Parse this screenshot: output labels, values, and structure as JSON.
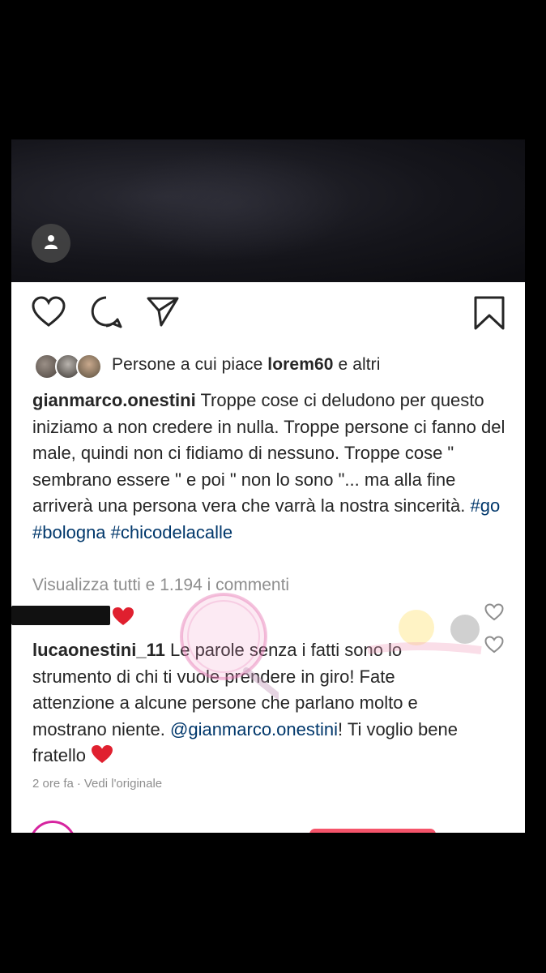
{
  "post": {
    "likes": {
      "prefix": "Persone a cui piace",
      "user": "lorem60",
      "suffix": "e altri"
    },
    "caption": {
      "username": "gianmarco.onestini",
      "text": "Troppe cose ci deludono per questo iniziamo a non credere in nulla. Troppe persone ci fanno del male, quindi non ci fidiamo di nessuno. Troppe cose \" sembrano essere \" e poi \" non lo sono \"... ma alla fine arriverà una persona vera che varrà la nostra sincerità.",
      "hashtags": [
        "#go",
        "#bologna",
        "#chicodelacalle"
      ]
    },
    "view_all_comments": "Visualizza tutti e 1.194 i commenti",
    "comment": {
      "username": "lucaonestini_11",
      "text_before_mention": "Le parole senza i fatti sono lo strumento di chi ti vuole prendere in giro! Fate attenzione a alcune persone che parlano molto e mostrano niente.",
      "mention": "@gianmarco.onestini",
      "text_after_mention": "! Ti voglio bene fratello",
      "time": "2 ore fa",
      "see_original": "Vedi l'originale"
    }
  },
  "icons": {
    "profile": "person-icon",
    "like": "heart-outline-icon",
    "comment": "comment-icon",
    "share": "send-icon",
    "save": "bookmark-icon"
  },
  "colors": {
    "link": "#00376b",
    "heart_red": "#e0202f",
    "muted": "#8e8e8e"
  }
}
